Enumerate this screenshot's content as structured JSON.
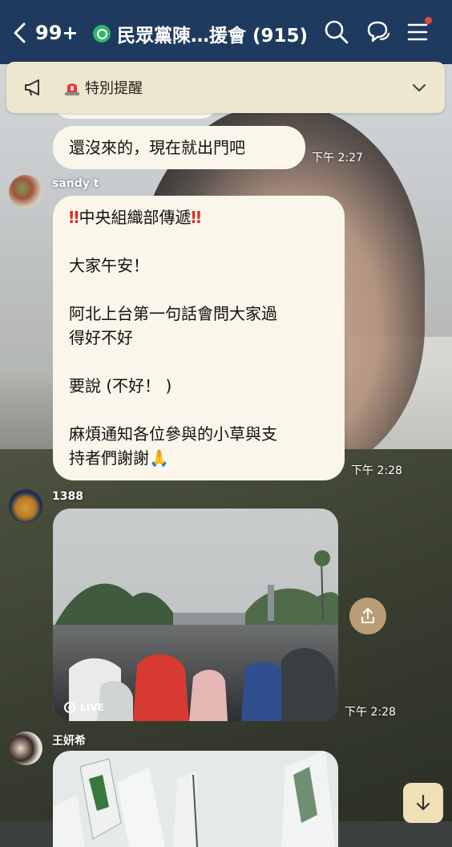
{
  "header": {
    "back_count": "99+",
    "title": "民眾黨陳…援會 (915)",
    "icons": [
      "search-icon",
      "chat-bubbles-icon",
      "menu-icon"
    ],
    "colors": {
      "bar": "#1f3a5f",
      "group_badge": "#2eb86b",
      "notification_dot": "#e8463a"
    }
  },
  "announcement": {
    "label": "特別提醒",
    "icons": [
      "megaphone-icon",
      "siren-icon",
      "chevron-down-icon"
    ]
  },
  "messages": [
    {
      "text": "還沒來的，現在就出門吧",
      "time": "下午 2:27"
    },
    {
      "sender": "sandy t",
      "head": "中央組織部傳遞",
      "lines": [
        "大家午安！",
        "阿北上台第一句話會問大家過\n得好不好",
        "要說 (不好！ )",
        "麻煩通知各位參與的小草與支\n持者們謝謝🙏"
      ],
      "time": "下午 2:28"
    },
    {
      "sender": "1388",
      "live_label": "LIVE",
      "time": "下午 2:28"
    },
    {
      "sender": "王妍希"
    }
  ]
}
